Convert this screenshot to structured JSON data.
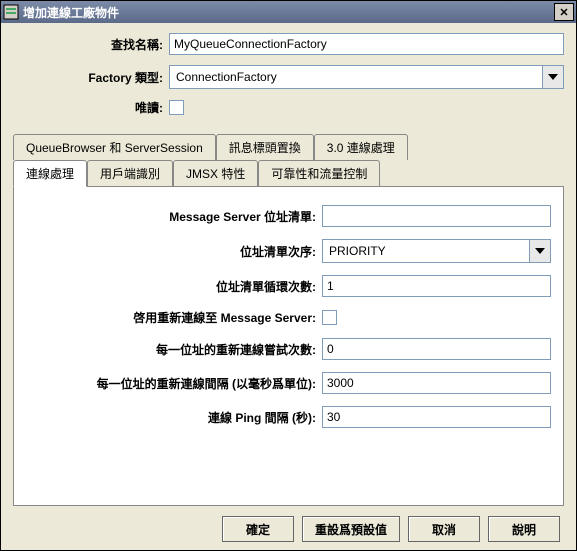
{
  "window": {
    "title": "增加連線工廠物件"
  },
  "form": {
    "lookup_label": "查找名稱:",
    "lookup_value": "MyQueueConnectionFactory",
    "factory_label": "Factory 類型:",
    "factory_value": "ConnectionFactory",
    "readonly_label": "唯讀:"
  },
  "tabs_row1": {
    "t0": "QueueBrowser 和 ServerSession",
    "t1": "訊息標頭置換",
    "t2": "3.0 連線處理"
  },
  "tabs_row2": {
    "t0": "連線處理",
    "t1": "用戶端識別",
    "t2": "JMSX 特性",
    "t3": "可靠性和流量控制"
  },
  "panel": {
    "msg_server_list_label": "Message Server 位址清單:",
    "msg_server_list_value": "",
    "list_order_label": "位址清單次序:",
    "list_order_value": "PRIORITY",
    "list_loop_label": "位址清單循環次數:",
    "list_loop_value": "1",
    "enable_reconnect_label": "啓用重新連線至 Message Server:",
    "retry_per_addr_label": "每一位址的重新連線嘗試次數:",
    "retry_per_addr_value": "0",
    "retry_interval_label": "每一位址的重新連線間隔 (以毫秒爲單位):",
    "retry_interval_value": "3000",
    "ping_interval_label": "連線 Ping 間隔 (秒):",
    "ping_interval_value": "30"
  },
  "buttons": {
    "ok": "確定",
    "reset": "重設爲預設值",
    "cancel": "取消",
    "help": "說明"
  }
}
